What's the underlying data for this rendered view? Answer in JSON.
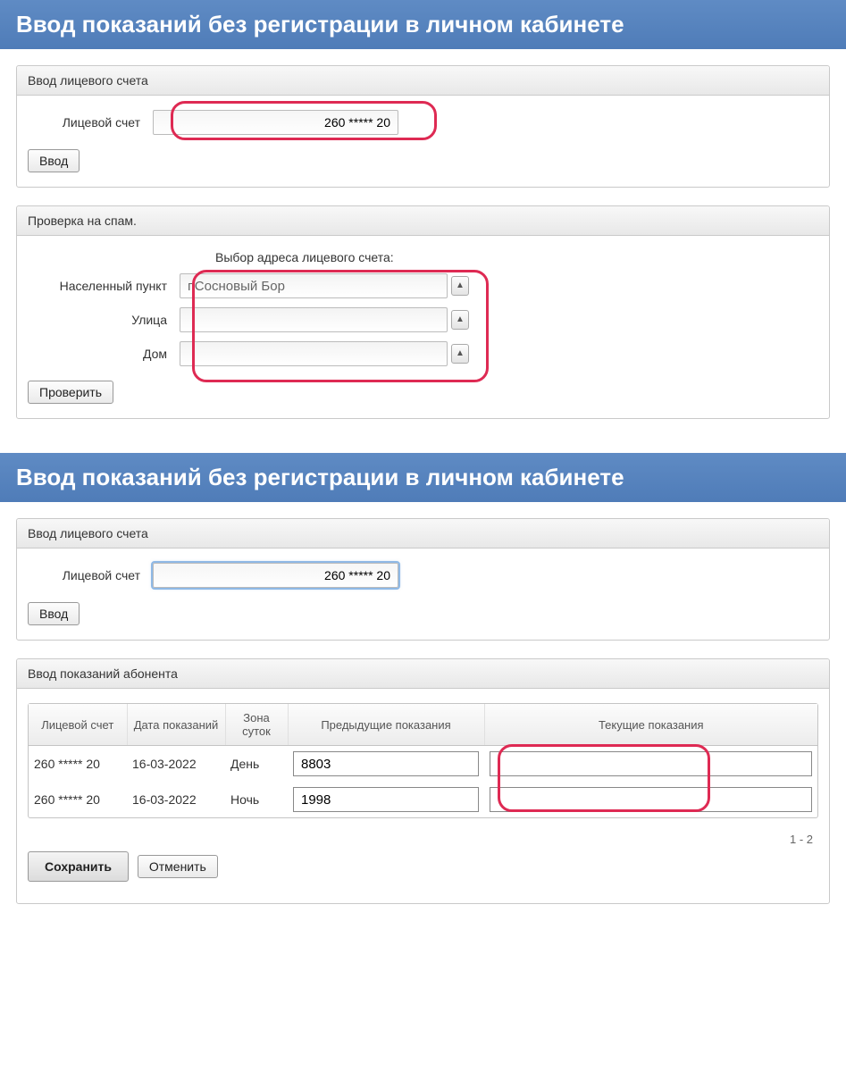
{
  "title1": "Ввод показаний без регистрации в личном кабинете",
  "panel_account": {
    "header": "Ввод лицевого счета",
    "label": "Лицевой счет",
    "value": "260 ***** 20",
    "submit": "Ввод"
  },
  "panel_spam": {
    "header": "Проверка на спам.",
    "heading": "Выбор адреса лицевого счета:",
    "city_label": "Населенный пункт",
    "city_value": "г.Сосновый Бор",
    "street_label": "Улица",
    "street_value": "",
    "house_label": "Дом",
    "house_value": "",
    "check": "Проверить"
  },
  "title2": "Ввод показаний без регистрации в личном кабинете",
  "panel_account2": {
    "header": "Ввод лицевого счета",
    "label": "Лицевой счет",
    "value": "260 ***** 20",
    "submit": "Ввод"
  },
  "panel_readings": {
    "header": "Ввод показаний абонента",
    "columns": {
      "acc": "Лицевой счет",
      "date": "Дата показаний",
      "zone": "Зона суток",
      "prev": "Предыдущие показания",
      "curr": "Текущие показания"
    },
    "rows": [
      {
        "acc": "260 ***** 20",
        "date": "16-03-2022",
        "zone": "День",
        "prev": "8803",
        "curr": ""
      },
      {
        "acc": "260 ***** 20",
        "date": "16-03-2022",
        "zone": "Ночь",
        "prev": "1998",
        "curr": ""
      }
    ],
    "pager": "1 - 2",
    "save": "Сохранить",
    "cancel": "Отменить"
  }
}
